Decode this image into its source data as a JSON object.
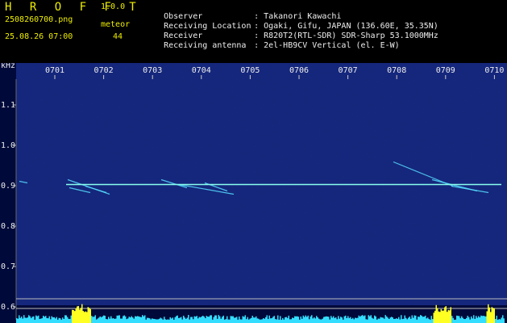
{
  "app": {
    "title": "H R O F F T",
    "version": "1.0.0"
  },
  "file": {
    "name": "2508260700.png",
    "datetime": "25.08.26 07:00"
  },
  "meteor": {
    "label": "meteor",
    "count": "44"
  },
  "info": [
    {
      "key": "Observer",
      "value": "Takanori Kawachi"
    },
    {
      "key": "Receiving Location",
      "value": "Ogaki, Gifu, JAPAN (136.60E, 35.35N)"
    },
    {
      "key": "Receiver",
      "value": "R820T2(RTL-SDR) SDR-Sharp 53.1000MHz"
    },
    {
      "key": "Receiving antenna",
      "value": "2el-HB9CV Vertical (el. E-W)"
    }
  ],
  "spectrogram": {
    "unit": "kHz",
    "time_ticks": [
      "0701",
      "0702",
      "0703",
      "0704",
      "0705",
      "0706",
      "0707",
      "0708",
      "0709",
      "0710"
    ],
    "freq_ticks": [
      "1.1",
      "1.0",
      "0.9",
      "0.8",
      "0.7",
      "0.6"
    ],
    "freq_range_khz": [
      0.57,
      1.15
    ],
    "carrier_khz": 0.903,
    "colors": {
      "background": "#000a3a",
      "carrier": "#88ffee",
      "echo": "#55ddff",
      "level_cyan": "#33ddff",
      "level_yellow": "#ffff22"
    }
  }
}
